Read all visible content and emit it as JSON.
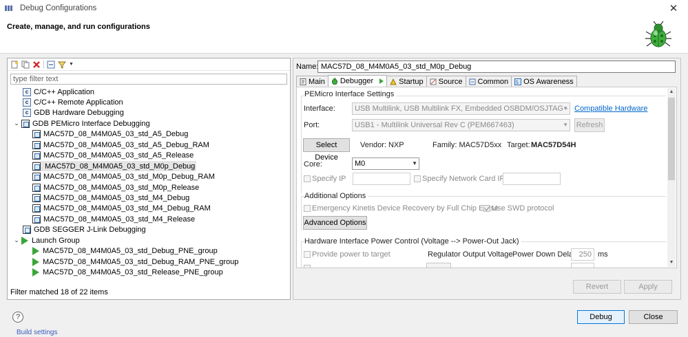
{
  "window": {
    "title": "Debug Configurations"
  },
  "header": {
    "title": "Create, manage, and run configurations"
  },
  "left": {
    "filter_placeholder": "type filter text",
    "tree": [
      {
        "label": "C/C++ Application",
        "kind": "c",
        "level": 1
      },
      {
        "label": "C/C++ Remote Application",
        "kind": "c",
        "level": 1
      },
      {
        "label": "GDB Hardware Debugging",
        "kind": "c",
        "level": 1
      },
      {
        "label": "GDB PEMicro Interface Debugging",
        "kind": "cfg",
        "level": 0,
        "expanded": true
      },
      {
        "label": "MAC57D_08_M4M0A5_03_std_A5_Debug",
        "kind": "cfg",
        "level": 2
      },
      {
        "label": "MAC57D_08_M4M0A5_03_std_A5_Debug_RAM",
        "kind": "cfg",
        "level": 2
      },
      {
        "label": "MAC57D_08_M4M0A5_03_std_A5_Release",
        "kind": "cfg",
        "level": 2
      },
      {
        "label": "MAC57D_08_M4M0A5_03_std_M0p_Debug",
        "kind": "cfg",
        "level": 2,
        "selected": true
      },
      {
        "label": "MAC57D_08_M4M0A5_03_std_M0p_Debug_RAM",
        "kind": "cfg",
        "level": 2
      },
      {
        "label": "MAC57D_08_M4M0A5_03_std_M0p_Release",
        "kind": "cfg",
        "level": 2
      },
      {
        "label": "MAC57D_08_M4M0A5_03_std_M4_Debug",
        "kind": "cfg",
        "level": 2
      },
      {
        "label": "MAC57D_08_M4M0A5_03_std_M4_Debug_RAM",
        "kind": "cfg",
        "level": 2
      },
      {
        "label": "MAC57D_08_M4M0A5_03_std_M4_Release",
        "kind": "cfg",
        "level": 2
      },
      {
        "label": "GDB SEGGER J-Link Debugging",
        "kind": "cfg",
        "level": 1
      },
      {
        "label": "Launch Group",
        "kind": "play",
        "level": 0,
        "expanded": true
      },
      {
        "label": "MAC57D_08_M4M0A5_03_std_Debug_PNE_group",
        "kind": "play",
        "level": 2
      },
      {
        "label": "MAC57D_08_M4M0A5_03_std_Debug_RAM_PNE_group",
        "kind": "play",
        "level": 2
      },
      {
        "label": "MAC57D_08_M4M0A5_03_std_Release_PNE_group",
        "kind": "play",
        "level": 2
      }
    ],
    "filter_status": "Filter matched 18 of 22 items"
  },
  "right": {
    "name_label": "Name:",
    "name_value": "MAC57D_08_M4M0A5_03_std_M0p_Debug",
    "tabs": [
      "Main",
      "Debugger",
      "Startup",
      "Source",
      "Common",
      "OS Awareness"
    ],
    "active_tab": "Debugger",
    "pemicro": {
      "group_label": "PEMicro Interface Settings",
      "interface_label": "Interface:",
      "interface_value": "USB Multilink, USB Multilink FX, Embedded OSBDM/OSJTAG - USB",
      "compat_link": "Compatible Hardware",
      "port_label": "Port:",
      "port_value": "USB1 - Multilink Universal Rev C (PEM667463)",
      "refresh": "Refresh",
      "select_device": "Select Device",
      "vendor": "Vendor: NXP",
      "family": "Family: MAC57D5xx",
      "target_label": "Target:",
      "target_value": "MAC57D54H",
      "core_label": "Core:",
      "core_value": "M0",
      "specify_ip": "Specify IP",
      "specify_network": "Specify Network Card IP"
    },
    "additional": {
      "group_label": "Additional Options",
      "emergency": "Emergency Kinetis Device Recovery by Full Chip Erase",
      "swd": "Use SWD protocol",
      "advanced": "Advanced Options"
    },
    "power": {
      "group_label": "Hardware Interface Power Control (Voltage --> Power-Out Jack)",
      "provide": "Provide power to target",
      "regulator": "Regulator Output Voltage",
      "pdd_label": "Power Down Delay",
      "pdd_value": "250",
      "pdd_unit": "ms"
    },
    "revert": "Revert",
    "apply": "Apply"
  },
  "footer": {
    "debug": "Debug",
    "close": "Close",
    "bg_fragment": "Build settings"
  }
}
